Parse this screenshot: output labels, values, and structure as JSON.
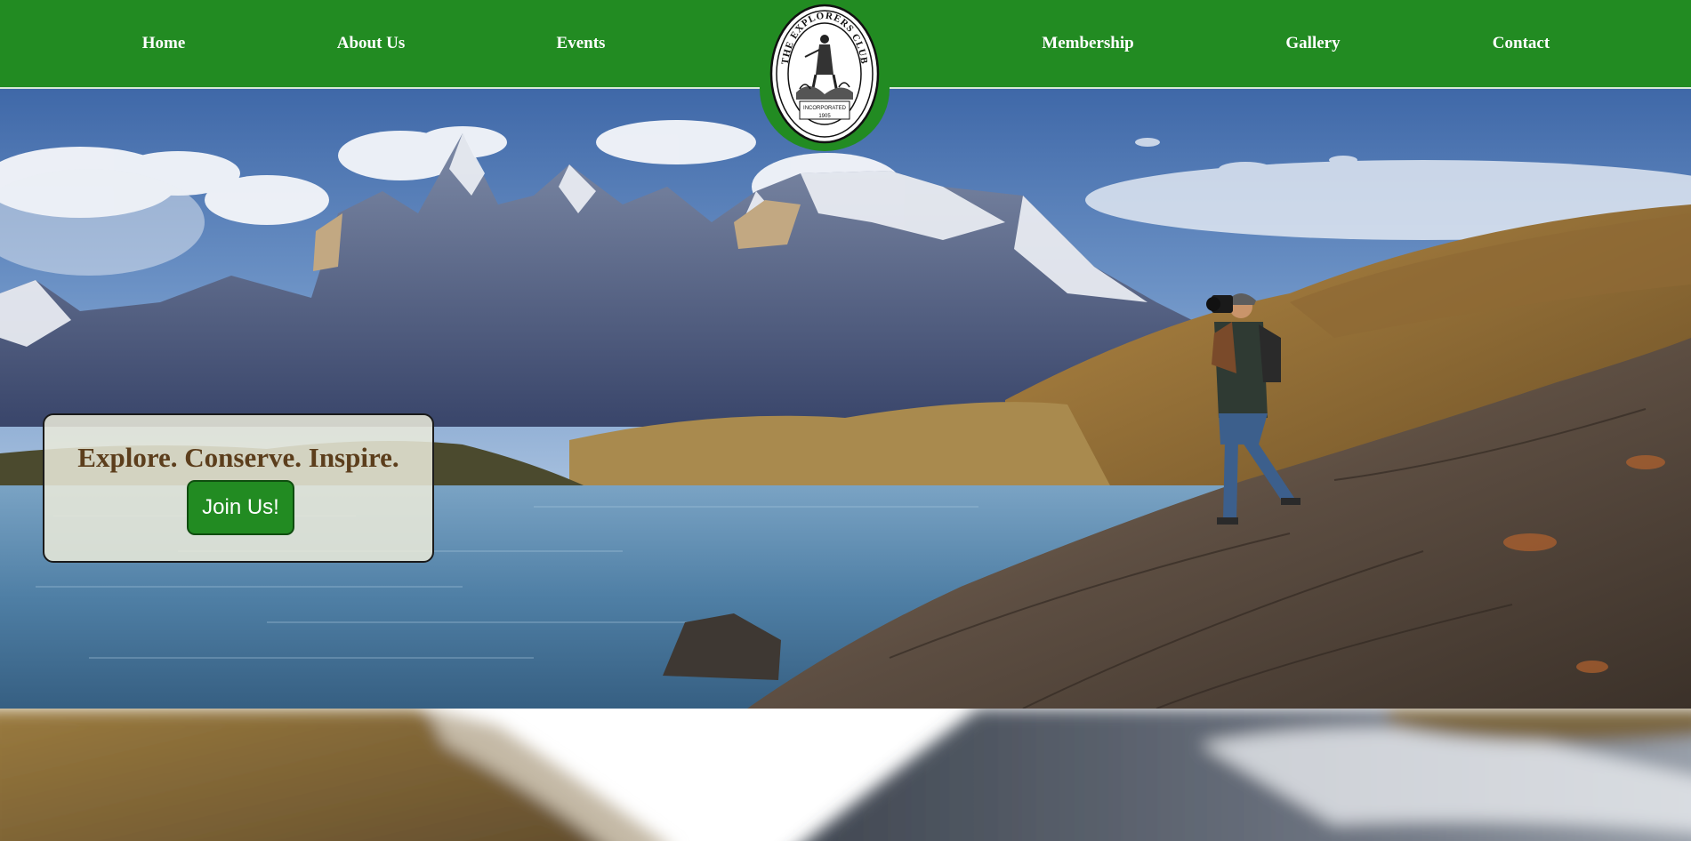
{
  "nav": {
    "links": [
      {
        "label": "Home"
      },
      {
        "label": "About Us"
      },
      {
        "label": "Events"
      },
      {
        "label": "Membership"
      },
      {
        "label": "Gallery"
      },
      {
        "label": "Contact"
      }
    ],
    "logo": {
      "ring_text": "THE EXPLORERS CLUB",
      "inner_text": "INCORPORATED",
      "year": "1905"
    }
  },
  "hero": {
    "tagline": "Explore. Conserve. Inspire.",
    "cta_label": "Join Us!"
  },
  "colors": {
    "brand_green": "#228b22",
    "tagline_brown": "#5c3e1c",
    "card_background": "#eaeada"
  }
}
